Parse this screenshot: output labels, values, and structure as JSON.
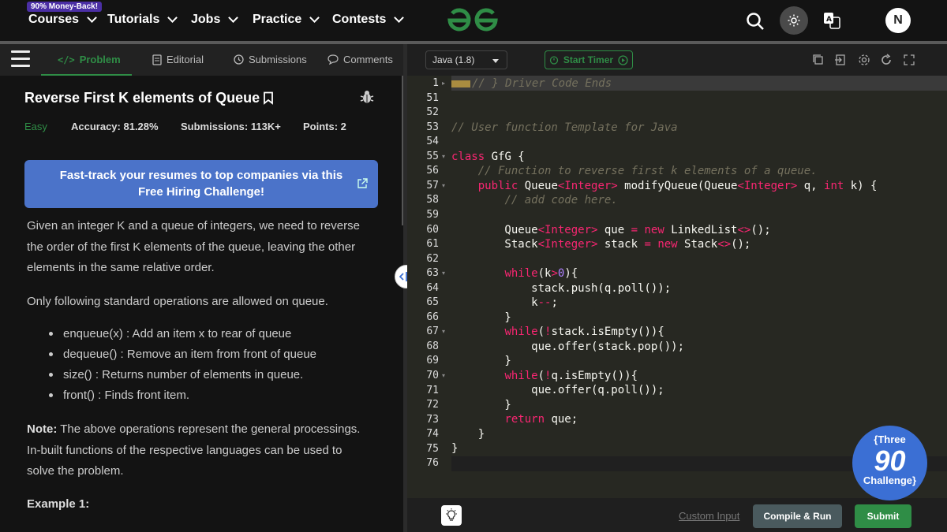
{
  "nav": {
    "badge": "90% Money-Back!",
    "items": [
      "Courses",
      "Tutorials",
      "Jobs",
      "Practice",
      "Contests"
    ],
    "avatar_initial": "N"
  },
  "tabs": [
    "Problem",
    "Editorial",
    "Submissions",
    "Comments"
  ],
  "problem": {
    "title": "Reverse First K elements of Queue",
    "difficulty": "Easy",
    "accuracy": "Accuracy: 81.28%",
    "submissions": "Submissions: 113K+",
    "points": "Points: 2",
    "banner": "Fast-track your resumes to top companies via this Free Hiring Challenge!",
    "desc_lines": [
      "Given an integer K and a queue of integers, we need to reverse",
      "the order of the first K elements of the queue, leaving the other",
      "elements in the same relative order."
    ],
    "ops_intro": "Only following standard operations are allowed on queue.",
    "ops": [
      "enqueue(x) : Add an item x to rear of queue",
      "dequeue() : Remove an item from front of queue",
      "size() : Returns number of elements in queue.",
      "front() : Finds front item."
    ],
    "note_label": "Note:",
    "note_lines": [
      " The above operations represent the general processings.",
      "In-built functions of the respective languages can be used to",
      "solve the problem."
    ],
    "example_label": "Example 1:"
  },
  "editor": {
    "language": "Java (1.8)",
    "timer": "Start Timer",
    "custom_input": "Custom Input",
    "compile": "Compile & Run",
    "submit": "Submit",
    "line_numbers": [
      "1",
      "51",
      "52",
      "53",
      "54",
      "55",
      "56",
      "57",
      "58",
      "59",
      "60",
      "61",
      "62",
      "63",
      "64",
      "65",
      "66",
      "67",
      "68",
      "69",
      "70",
      "71",
      "72",
      "73",
      "74",
      "75",
      "76"
    ]
  },
  "challenge": {
    "line1": "{Three",
    "line2": "90",
    "line3": "Challenge}"
  },
  "colors": {
    "accent_green": "#2f8d46",
    "banner_blue": "#4b73c9",
    "challenge_blue": "#3b6fd4"
  }
}
